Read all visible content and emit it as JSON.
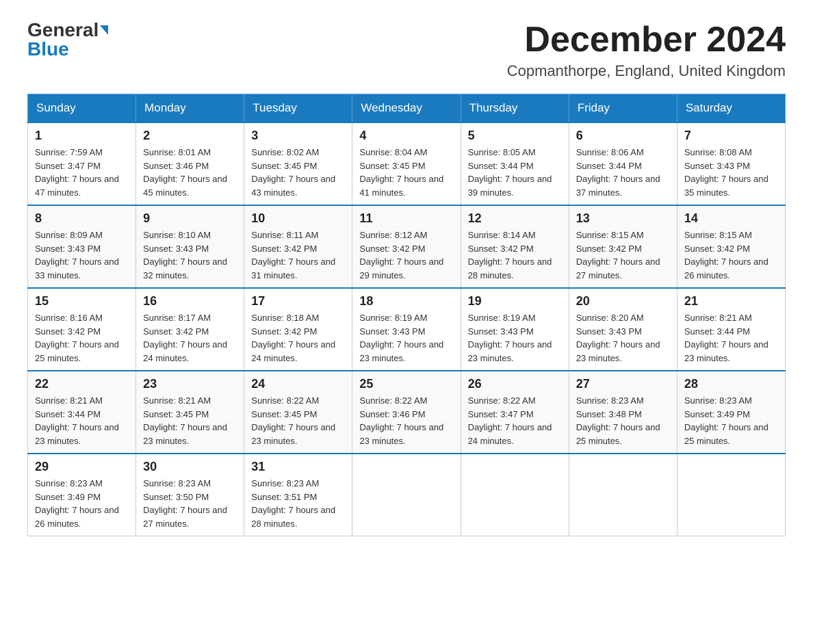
{
  "header": {
    "logo_general": "General",
    "logo_blue": "Blue",
    "month_title": "December 2024",
    "location": "Copmanthorpe, England, United Kingdom"
  },
  "days_of_week": [
    "Sunday",
    "Monday",
    "Tuesday",
    "Wednesday",
    "Thursday",
    "Friday",
    "Saturday"
  ],
  "weeks": [
    [
      {
        "day": "1",
        "sunrise": "7:59 AM",
        "sunset": "3:47 PM",
        "daylight": "7 hours and 47 minutes."
      },
      {
        "day": "2",
        "sunrise": "8:01 AM",
        "sunset": "3:46 PM",
        "daylight": "7 hours and 45 minutes."
      },
      {
        "day": "3",
        "sunrise": "8:02 AM",
        "sunset": "3:45 PM",
        "daylight": "7 hours and 43 minutes."
      },
      {
        "day": "4",
        "sunrise": "8:04 AM",
        "sunset": "3:45 PM",
        "daylight": "7 hours and 41 minutes."
      },
      {
        "day": "5",
        "sunrise": "8:05 AM",
        "sunset": "3:44 PM",
        "daylight": "7 hours and 39 minutes."
      },
      {
        "day": "6",
        "sunrise": "8:06 AM",
        "sunset": "3:44 PM",
        "daylight": "7 hours and 37 minutes."
      },
      {
        "day": "7",
        "sunrise": "8:08 AM",
        "sunset": "3:43 PM",
        "daylight": "7 hours and 35 minutes."
      }
    ],
    [
      {
        "day": "8",
        "sunrise": "8:09 AM",
        "sunset": "3:43 PM",
        "daylight": "7 hours and 33 minutes."
      },
      {
        "day": "9",
        "sunrise": "8:10 AM",
        "sunset": "3:43 PM",
        "daylight": "7 hours and 32 minutes."
      },
      {
        "day": "10",
        "sunrise": "8:11 AM",
        "sunset": "3:42 PM",
        "daylight": "7 hours and 31 minutes."
      },
      {
        "day": "11",
        "sunrise": "8:12 AM",
        "sunset": "3:42 PM",
        "daylight": "7 hours and 29 minutes."
      },
      {
        "day": "12",
        "sunrise": "8:14 AM",
        "sunset": "3:42 PM",
        "daylight": "7 hours and 28 minutes."
      },
      {
        "day": "13",
        "sunrise": "8:15 AM",
        "sunset": "3:42 PM",
        "daylight": "7 hours and 27 minutes."
      },
      {
        "day": "14",
        "sunrise": "8:15 AM",
        "sunset": "3:42 PM",
        "daylight": "7 hours and 26 minutes."
      }
    ],
    [
      {
        "day": "15",
        "sunrise": "8:16 AM",
        "sunset": "3:42 PM",
        "daylight": "7 hours and 25 minutes."
      },
      {
        "day": "16",
        "sunrise": "8:17 AM",
        "sunset": "3:42 PM",
        "daylight": "7 hours and 24 minutes."
      },
      {
        "day": "17",
        "sunrise": "8:18 AM",
        "sunset": "3:42 PM",
        "daylight": "7 hours and 24 minutes."
      },
      {
        "day": "18",
        "sunrise": "8:19 AM",
        "sunset": "3:43 PM",
        "daylight": "7 hours and 23 minutes."
      },
      {
        "day": "19",
        "sunrise": "8:19 AM",
        "sunset": "3:43 PM",
        "daylight": "7 hours and 23 minutes."
      },
      {
        "day": "20",
        "sunrise": "8:20 AM",
        "sunset": "3:43 PM",
        "daylight": "7 hours and 23 minutes."
      },
      {
        "day": "21",
        "sunrise": "8:21 AM",
        "sunset": "3:44 PM",
        "daylight": "7 hours and 23 minutes."
      }
    ],
    [
      {
        "day": "22",
        "sunrise": "8:21 AM",
        "sunset": "3:44 PM",
        "daylight": "7 hours and 23 minutes."
      },
      {
        "day": "23",
        "sunrise": "8:21 AM",
        "sunset": "3:45 PM",
        "daylight": "7 hours and 23 minutes."
      },
      {
        "day": "24",
        "sunrise": "8:22 AM",
        "sunset": "3:45 PM",
        "daylight": "7 hours and 23 minutes."
      },
      {
        "day": "25",
        "sunrise": "8:22 AM",
        "sunset": "3:46 PM",
        "daylight": "7 hours and 23 minutes."
      },
      {
        "day": "26",
        "sunrise": "8:22 AM",
        "sunset": "3:47 PM",
        "daylight": "7 hours and 24 minutes."
      },
      {
        "day": "27",
        "sunrise": "8:23 AM",
        "sunset": "3:48 PM",
        "daylight": "7 hours and 25 minutes."
      },
      {
        "day": "28",
        "sunrise": "8:23 AM",
        "sunset": "3:49 PM",
        "daylight": "7 hours and 25 minutes."
      }
    ],
    [
      {
        "day": "29",
        "sunrise": "8:23 AM",
        "sunset": "3:49 PM",
        "daylight": "7 hours and 26 minutes."
      },
      {
        "day": "30",
        "sunrise": "8:23 AM",
        "sunset": "3:50 PM",
        "daylight": "7 hours and 27 minutes."
      },
      {
        "day": "31",
        "sunrise": "8:23 AM",
        "sunset": "3:51 PM",
        "daylight": "7 hours and 28 minutes."
      },
      null,
      null,
      null,
      null
    ]
  ]
}
